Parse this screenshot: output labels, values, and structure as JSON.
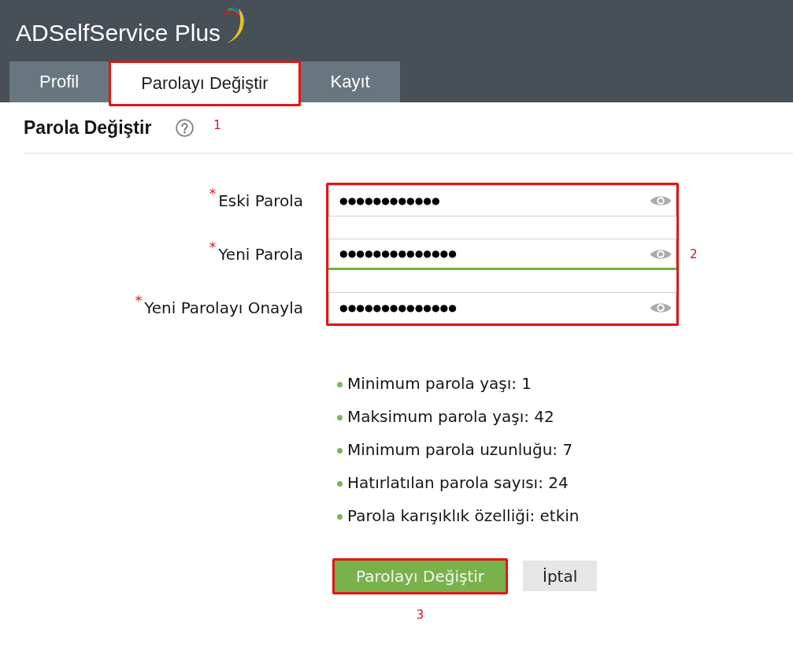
{
  "header": {
    "logo": "ADSelfService Plus"
  },
  "tabs": [
    {
      "label": "Profil",
      "selected": false,
      "highlighted": false
    },
    {
      "label": "Parolayı Değiştir",
      "selected": true,
      "highlighted": true
    },
    {
      "label": "Kayıt",
      "selected": false,
      "highlighted": false
    }
  ],
  "page_header": {
    "title": "Parola Değiştir",
    "callout": "1"
  },
  "form": {
    "highlighted": true,
    "callout": "2",
    "fields": [
      {
        "required_mark": "*",
        "label": "Eski Parola",
        "value": "●●●●●●●●●●●●"
      },
      {
        "required_mark": "*",
        "label": "Yeni Parola",
        "value": "●●●●●●●●●●●●●●",
        "strength_meter": {
          "level": 1
        }
      },
      {
        "required_mark": "*",
        "label": "Yeni Parolayı Onayla",
        "value": "●●●●●●●●●●●●●●"
      }
    ]
  },
  "policy": [
    "Minimum parola yaşı: 1",
    "Maksimum parola yaşı: 42",
    "Minimum parola uzunluğu: 7",
    "Hatırlatılan parola sayısı: 24",
    "Parola karışıklık özelliği: etkin"
  ],
  "buttons": [
    {
      "kind": "primary",
      "label": "Parolayı Değiştir",
      "highlighted": true,
      "callout": "3"
    },
    {
      "kind": "secondary",
      "label": "İptal",
      "highlighted": false
    }
  ]
}
